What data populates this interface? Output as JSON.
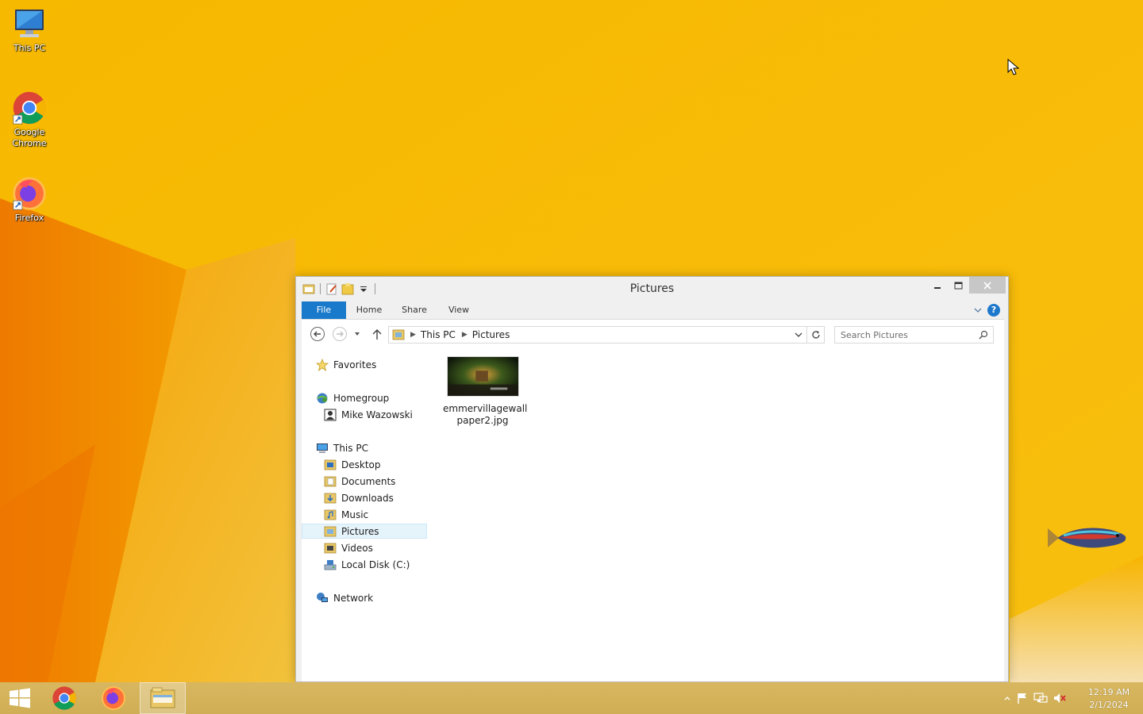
{
  "desktop": {
    "icons": [
      {
        "label": "This PC",
        "icon": "this-pc-icon"
      },
      {
        "label": "Google Chrome",
        "icon": "chrome-icon"
      },
      {
        "label": "Firefox",
        "icon": "firefox-icon"
      }
    ]
  },
  "window": {
    "title": "Pictures",
    "ribbon_tabs": [
      "File",
      "Home",
      "Share",
      "View"
    ],
    "help_label": "?",
    "address": {
      "crumbs": [
        "This PC",
        "Pictures"
      ]
    },
    "search": {
      "placeholder": "Search Pictures"
    },
    "nav_pane": {
      "favorites": "Favorites",
      "homegroup": "Homegroup",
      "homegroup_user": "Mike Wazowski",
      "this_pc": "This PC",
      "this_pc_children": [
        "Desktop",
        "Documents",
        "Downloads",
        "Music",
        "Pictures",
        "Videos",
        "Local Disk (C:)"
      ],
      "network": "Network",
      "selected": "Pictures"
    },
    "files": [
      {
        "name": "emmervillagewallpaper2.jpg",
        "name_line1": "emmervillagewall",
        "name_line2": "paper2.jpg"
      }
    ]
  },
  "taskbar": {
    "apps": [
      "start",
      "chrome",
      "firefox",
      "file-explorer"
    ],
    "clock_time": "12:19 AM",
    "clock_date": "2/1/2024"
  },
  "colors": {
    "accent": "#1979ca",
    "wallpaper": "#f6b400",
    "taskbar": "#d2b66c"
  }
}
